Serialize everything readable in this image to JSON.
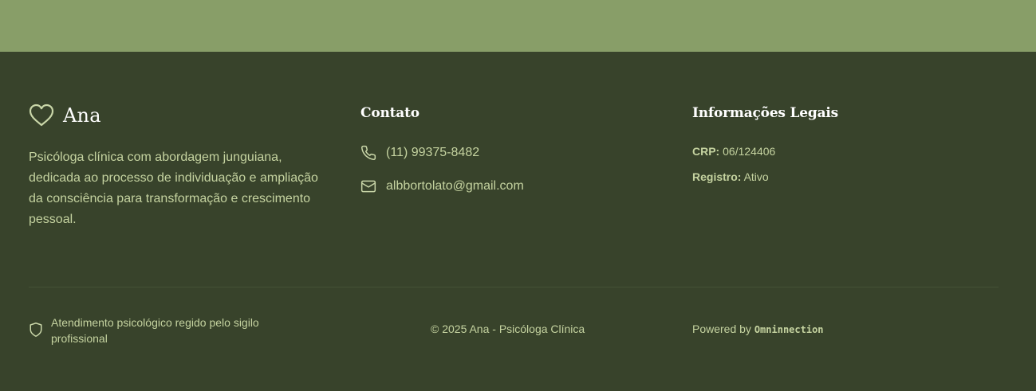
{
  "brand": {
    "name": "Ana",
    "icon": "heart-icon",
    "description": "Psicóloga clínica com abordagem junguiana, dedicada ao processo de individuação e ampliação da consciência para transformação e crescimento pessoal."
  },
  "contact": {
    "title": "Contato",
    "phone": "(11) 99375-8482",
    "phone_icon": "phone-icon",
    "email": "albbortolato@gmail.com",
    "email_icon": "mail-icon"
  },
  "legal": {
    "title": "Informações Legais",
    "crp_label": "CRP:",
    "crp_value": "06/124406",
    "registro_label": "Registro:",
    "registro_value": "Ativo"
  },
  "bottom": {
    "sigilo_icon": "shield-icon",
    "sigilo_text": "Atendimento psicológico regido pelo sigilo profissional",
    "copyright": "© 2025 Ana - Psicóloga Clínica",
    "powered_prefix": "Powered by",
    "powered_brand": "Omninnection"
  },
  "colors": {
    "top_band": "#889e68",
    "footer_bg": "#38432b",
    "text": "#c5d3a0",
    "heading": "#ffffff"
  }
}
